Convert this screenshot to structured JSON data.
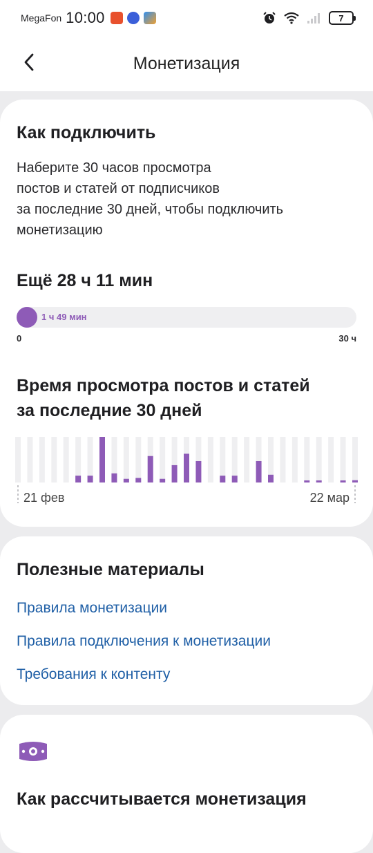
{
  "status_bar": {
    "carrier": "MegaFon",
    "time": "10:00",
    "battery": "7"
  },
  "header": {
    "title": "Монетизация"
  },
  "how_to_connect": {
    "title": "Как подключить",
    "description_lines": [
      "Наберите 30 часов просмотра",
      "постов и статей от подписчиков",
      "за последние 30 дней, чтобы подключить",
      "монетизацию"
    ],
    "remaining": "Ещё 28 ч 11 мин",
    "progress": {
      "current_label": "1 ч 49 мин",
      "fraction": 0.0606,
      "min_label": "0",
      "max_label": "30 ч"
    }
  },
  "view_time": {
    "title_lines": [
      "Время просмотра постов и статей",
      "за последние 30 дней"
    ],
    "start_label": "21 фев",
    "end_label": "22 мар"
  },
  "chart_data": {
    "type": "bar",
    "x_start": "21 фев",
    "x_end": "22 мар",
    "values": [
      0,
      0,
      0,
      0,
      0,
      0.15,
      0.15,
      1.0,
      0.2,
      0.08,
      0.1,
      0.58,
      0.08,
      0.38,
      0.63,
      0.47,
      0,
      0.15,
      0.15,
      0,
      0.47,
      0.17,
      0,
      0,
      0.02,
      0.02,
      0,
      0.02,
      0.05
    ],
    "ylim": [
      0,
      1
    ],
    "bar_color": "#8e5bb7",
    "track_color": "#efeff1"
  },
  "materials": {
    "title": "Полезные материалы",
    "links": [
      "Правила монетизации",
      "Правила подключения к монетизации",
      "Требования к контенту"
    ]
  },
  "calculation": {
    "icon": "money-icon",
    "title": "Как рассчитывается монетизация"
  },
  "colors": {
    "accent": "#8e5bb7",
    "link": "#1f5fa6",
    "background": "#ececee"
  }
}
